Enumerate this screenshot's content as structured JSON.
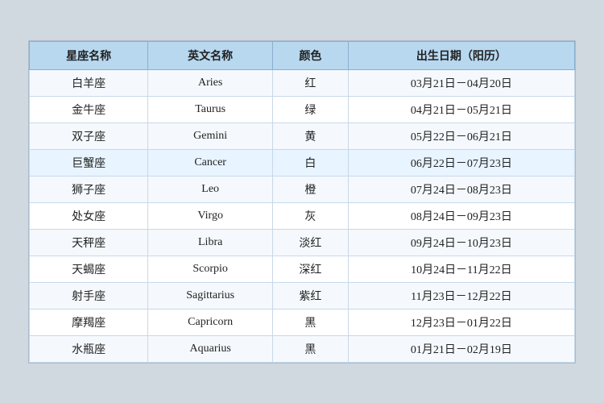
{
  "table": {
    "headers": [
      "星座名称",
      "英文名称",
      "颜色",
      "出生日期（阳历）"
    ],
    "rows": [
      {
        "zh": "白羊座",
        "en": "Aries",
        "color": "红",
        "date": "03月21日－04月20日",
        "highlight": false
      },
      {
        "zh": "金牛座",
        "en": "Taurus",
        "color": "绿",
        "date": "04月21日－05月21日",
        "highlight": false
      },
      {
        "zh": "双子座",
        "en": "Gemini",
        "color": "黄",
        "date": "05月22日－06月21日",
        "highlight": false
      },
      {
        "zh": "巨蟹座",
        "en": "Cancer",
        "color": "白",
        "date": "06月22日－07月23日",
        "highlight": true
      },
      {
        "zh": "狮子座",
        "en": "Leo",
        "color": "橙",
        "date": "07月24日－08月23日",
        "highlight": false
      },
      {
        "zh": "处女座",
        "en": "Virgo",
        "color": "灰",
        "date": "08月24日－09月23日",
        "highlight": false
      },
      {
        "zh": "天秤座",
        "en": "Libra",
        "color": "淡红",
        "date": "09月24日－10月23日",
        "highlight": false
      },
      {
        "zh": "天蝎座",
        "en": "Scorpio",
        "color": "深红",
        "date": "10月24日－11月22日",
        "highlight": false
      },
      {
        "zh": "射手座",
        "en": "Sagittarius",
        "color": "紫红",
        "date": "11月23日－12月22日",
        "highlight": false
      },
      {
        "zh": "摩羯座",
        "en": "Capricorn",
        "color": "黑",
        "date": "12月23日－01月22日",
        "highlight": false
      },
      {
        "zh": "水瓶座",
        "en": "Aquarius",
        "color": "黑",
        "date": "01月21日－02月19日",
        "highlight": false
      }
    ]
  }
}
